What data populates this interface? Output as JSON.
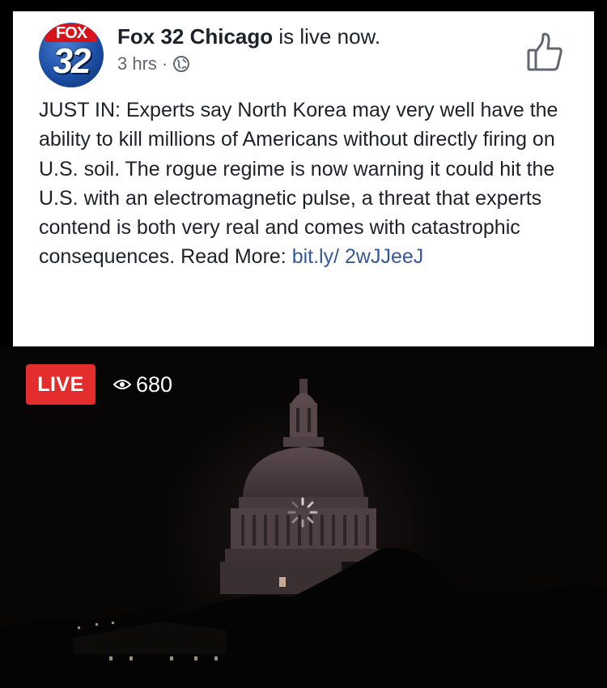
{
  "post": {
    "page_name": "Fox 32 Chicago",
    "status_text": " is live now.",
    "time": "3 hrs",
    "separator": "·",
    "avatar": {
      "top_text": "FOX",
      "number": "32"
    },
    "text": "JUST IN: Experts say North Korea may very well have the ability to kill millions of Americans without directly firing on U.S. soil. The rogue regime is now warning it could hit the U.S. with an electromagnetic pulse, a threat that experts contend is both very real and comes with catastrophic consequences. Read More: ",
    "link": "bit.ly/ 2wJJeeJ",
    "icons": {
      "privacy": "globe-icon",
      "like": "thumbs-up-icon"
    }
  },
  "video": {
    "live_label": "LIVE",
    "viewer_count": "680",
    "icons": {
      "viewers": "eye-icon",
      "loading": "spinner-icon"
    }
  },
  "colors": {
    "live_badge": "#e42d2d",
    "link": "#365899",
    "text": "#1d2129",
    "meta": "#616770"
  }
}
